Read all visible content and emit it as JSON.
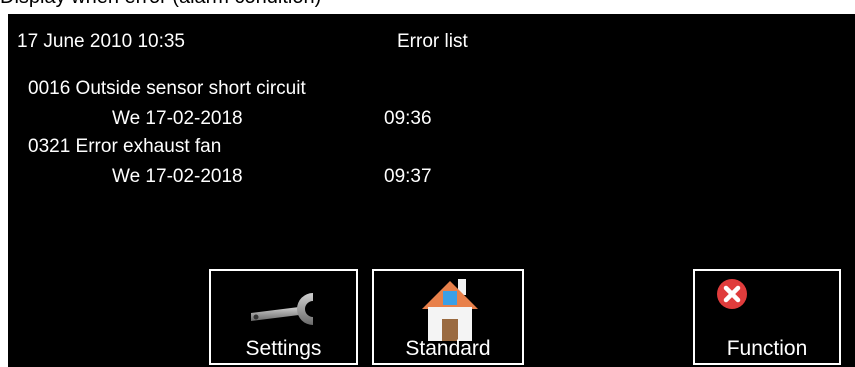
{
  "caption": "Display when error (alarm condition)",
  "header": {
    "datetime": "17 June 2010 10:35",
    "title": "Error list"
  },
  "errors": [
    {
      "text": "0016 Outside sensor short circuit",
      "date": "We 17-02-2018",
      "time": "09:36"
    },
    {
      "text": "0321 Error exhaust fan",
      "date": "We 17-02-2018",
      "time": "09:37"
    }
  ],
  "buttons": {
    "settings": {
      "label": "Settings",
      "icon": "wrench-icon"
    },
    "standard": {
      "label": "Standard",
      "icon": "house-icon"
    },
    "function": {
      "label": "Function",
      "icon": "error-x-icon",
      "icon_color": "#e03c3c"
    }
  },
  "colors": {
    "background": "#000000",
    "text": "#ffffff"
  }
}
